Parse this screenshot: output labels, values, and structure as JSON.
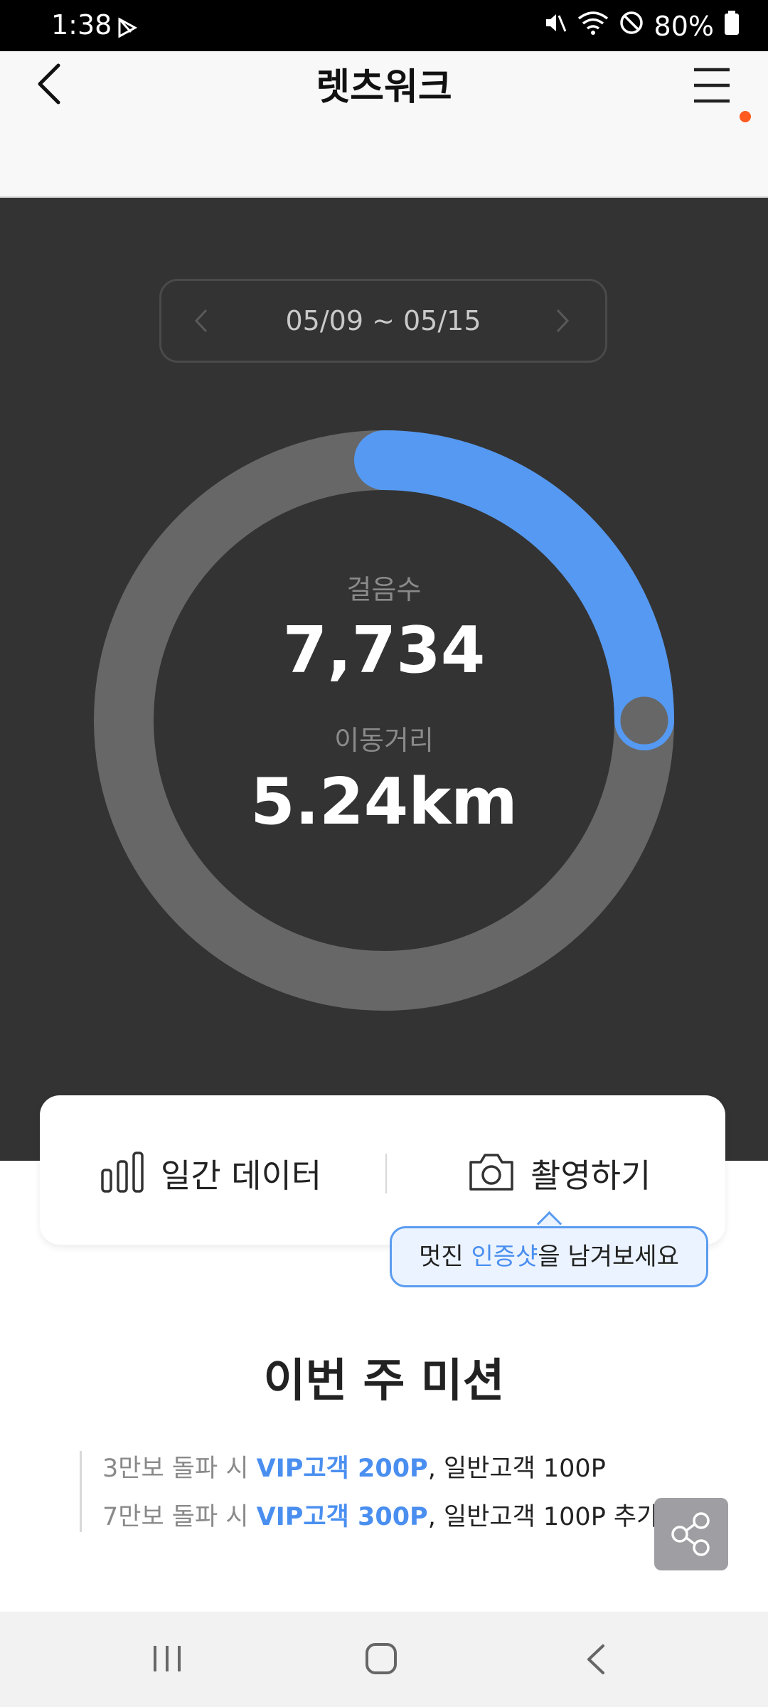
{
  "status": {
    "time": "1:38",
    "battery": "80%"
  },
  "header": {
    "title": "렛츠워크"
  },
  "date_range": {
    "label": "05/09 ~ 05/15"
  },
  "progress": {
    "steps_label": "걸음수",
    "steps_value": "7,734",
    "distance_label": "이동거리",
    "distance_value": "5.24km",
    "ring_fraction": 0.25,
    "ring_color": "#5599f2",
    "track_color": "#676767"
  },
  "actions": {
    "daily_label": "일간 데이터",
    "camera_label": "촬영하기",
    "tooltip_before": "멋진 ",
    "tooltip_highlight": "인증샷",
    "tooltip_after": "을 남겨보세요"
  },
  "mission": {
    "title": "이번 주 미션",
    "items": [
      {
        "prefix": "3만보 돌파 시 ",
        "vip": "VIP고객 200P",
        "suffix": ", 일반고객 100P"
      },
      {
        "prefix": "7만보 돌파 시 ",
        "vip": "VIP고객 300P",
        "suffix": ", 일반고객 100P 추가지급"
      }
    ]
  },
  "icons": {
    "back": "chevron-left-icon",
    "menu": "hamburger-menu-icon",
    "daily": "bar-chart-icon",
    "camera": "camera-icon",
    "share": "share-icon"
  }
}
